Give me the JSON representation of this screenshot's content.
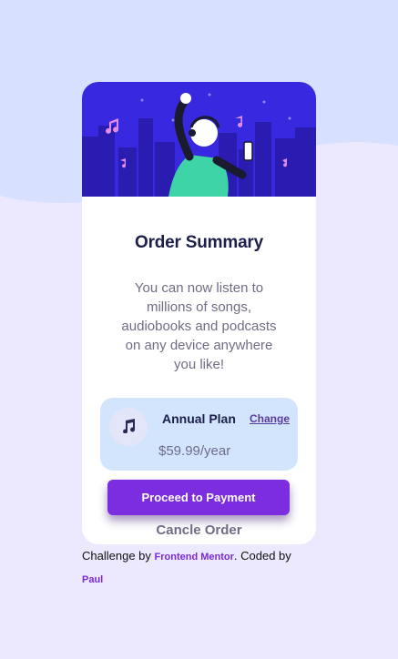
{
  "card": {
    "title": "Order Summary",
    "description": "You can now listen to millions of songs, audiobooks and podcasts on any device anywhere you like!"
  },
  "plan": {
    "name": "Annual Plan",
    "price": "$59.99/year",
    "change_label": "Change",
    "icon": "music-note-icon"
  },
  "actions": {
    "proceed_label": "Proceed to Payment",
    "cancel_label": "Cancle Order"
  },
  "attribution": {
    "challenge_prefix": "Challenge by ",
    "challenge_link": "Frontend Mentor",
    "coded_by": ". Coded by ",
    "author": "Paul"
  },
  "colors": {
    "background": "#ece9fe",
    "background_wave": "#d7e0fe",
    "hero": "#3829e0",
    "accent": "#7c2de0",
    "plan_bg": "#d3e5fd",
    "title": "#1c1f4a"
  }
}
